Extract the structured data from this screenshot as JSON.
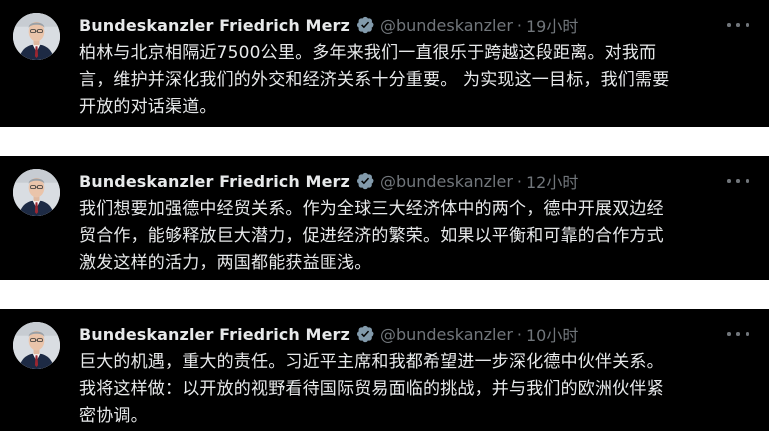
{
  "colors": {
    "background": "#000000",
    "gap": "#ffffff",
    "text_primary": "#e7e9ea",
    "text_secondary": "#71767b",
    "verified_badge": "#829aab"
  },
  "icons": {
    "avatar": "profile-photo",
    "verified": "verified-badge-icon",
    "more": "more-options-icon"
  },
  "tweets": [
    {
      "author": {
        "name": "Bundeskanzler Friedrich Merz",
        "handle": "@bundeskanzler"
      },
      "separator": "·",
      "time": "19小时",
      "lines": [
        "柏林与北京相隔近7500公里。多年来我们一直很乐于跨越这段距离。对我而",
        "言，维护并深化我们的外交和经济关系十分重要。 为实现这一目标，我们需要",
        "开放的对话渠道。"
      ]
    },
    {
      "author": {
        "name": "Bundeskanzler Friedrich Merz",
        "handle": "@bundeskanzler"
      },
      "separator": "·",
      "time": "12小时",
      "lines": [
        "我们想要加强德中经贸关系。作为全球三大经济体中的两个，德中开展双边经",
        "贸合作，能够释放巨大潜力，促进经济的繁荣。如果以平衡和可靠的合作方式",
        "激发这样的活力，两国都能获益匪浅。"
      ]
    },
    {
      "author": {
        "name": "Bundeskanzler Friedrich Merz",
        "handle": "@bundeskanzler"
      },
      "separator": "·",
      "time": "10小时",
      "lines": [
        "巨大的机遇，重大的责任。习近平主席和我都希望进一步深化德中伙伴关系。",
        "我将这样做：以开放的视野看待国际贸易面临的挑战，并与我们的欧洲伙伴紧",
        "密协调。"
      ]
    }
  ]
}
